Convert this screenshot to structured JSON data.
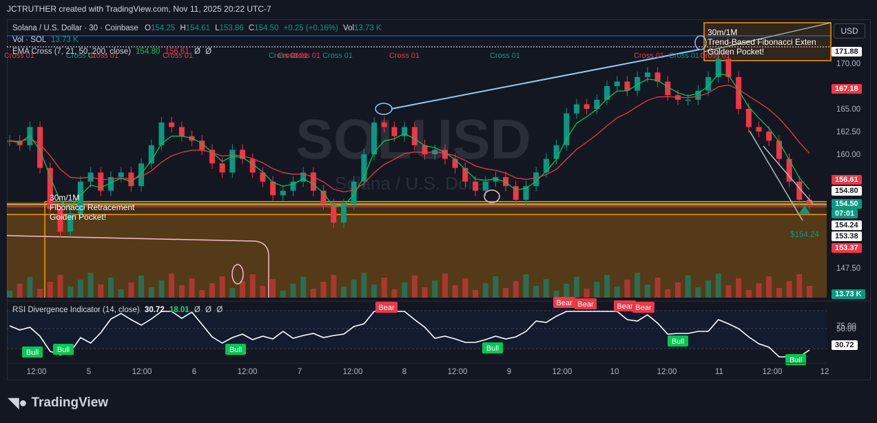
{
  "header": {
    "title": "JCTRUTHER created with TradingView.com, Nov 11, 2025 20:22 UTC-7"
  },
  "symbol": {
    "name": "Solana / U.S. Dollar · 30 · Coinbase",
    "o_label": "O",
    "o": "154.25",
    "h_label": "H",
    "h": "154.61",
    "l_label": "L",
    "l": "153.86",
    "c_label": "C",
    "c": "154.50",
    "change": "+0.25 (+0.16%)",
    "vol_label": "Vol",
    "vol": "13.73 K"
  },
  "vol_row": {
    "label": "Vol · SOL",
    "value": "13.73 K"
  },
  "ema_row": {
    "label": "EMA Cross (7, 21, 50, 200, close)",
    "v1": "154.80",
    "v2": "156.61",
    "v3": "Ø",
    "v4": "Ø"
  },
  "rsi_row": {
    "label": "RSI Divergence Indicator (14, close)",
    "v1": "30.72",
    "v2": "18.01",
    "v3": "Ø",
    "v4": "Ø",
    "v5": "Ø"
  },
  "currency_button": "USD",
  "watermark": {
    "ticker": "SOLUSD",
    "name": "Solana / U.S. Dollar"
  },
  "fib_left": {
    "line1": "30m/1M",
    "line2": "Fibonacci Retracement",
    "line3": "Golden Pocket!"
  },
  "fib_right": {
    "line1": "30m/1M",
    "line2": "Trend-Based Fibonacci Exten",
    "line3": "Golden Pocket!"
  },
  "cross_labels": [
    "Cross 01",
    "Cross 01",
    "Cross 01",
    "Cross 01",
    "Cross 01",
    "Cross 01",
    "Cross 01",
    "Cross 01",
    "Cross 01",
    "Cross 01",
    "Cross 01",
    "Cross 01",
    "Cross 01"
  ],
  "bull_label": "Bull",
  "bear_label": "Bear",
  "price_tags": [
    {
      "text": "171.88",
      "bg": "#ffffff",
      "fg": "#131722"
    },
    {
      "text": "167.18",
      "bg": "#f23645",
      "fg": "#ffffff"
    },
    {
      "text": "156.61",
      "bg": "#f23645",
      "fg": "#ffffff"
    },
    {
      "text": "154.80",
      "bg": "#ffffff",
      "fg": "#131722"
    },
    {
      "text": "154.50",
      "bg": "#089981",
      "fg": "#ffffff"
    },
    {
      "text": "07:01",
      "bg": "#089981",
      "fg": "#ffffff"
    },
    {
      "text": "154.24",
      "bg": "#ffffff",
      "fg": "#131722"
    },
    {
      "text": "153.38",
      "bg": "#ffffff",
      "fg": "#131722"
    },
    {
      "text": "153.37",
      "bg": "#f23645",
      "fg": "#ffffff"
    },
    {
      "text": "13.73 K",
      "bg": "#089981",
      "fg": "#ffffff"
    },
    {
      "text": "30.72",
      "bg": "#ffffff",
      "fg": "#131722"
    }
  ],
  "last_price_label": "$154.24",
  "logo": "TradingView",
  "colors": {
    "up": "#089981",
    "down": "#f23645",
    "ema_fast": "#00c853",
    "ema_slow": "#f23645",
    "fib_box": "#ff9800",
    "trendline": "#90caf9",
    "rsi": "#ffffff"
  },
  "chart_data": {
    "type": "candlestick",
    "symbol": "SOLUSD",
    "timeframe": "30",
    "y_axis_ticks": [
      145.0,
      147.5,
      150.0,
      152.5,
      155.0,
      157.5,
      160.0,
      162.5,
      165.0,
      167.5,
      170.0
    ],
    "y_axis_labels": [
      "147.50",
      "160.00",
      "162.50",
      "165.00",
      "170.00"
    ],
    "ylim": [
      145.0,
      172.5
    ],
    "x_axis_labels": [
      "12:00",
      "5",
      "12:00",
      "6",
      "12:00",
      "7",
      "12:00",
      "8",
      "12:00",
      "9",
      "12:00",
      "10",
      "12:00",
      "11",
      "12:00",
      "12"
    ],
    "key_levels": {
      "fib_upper": 154.8,
      "fib_lower": 153.38,
      "ema_fast": 154.8,
      "ema_slow": 156.61,
      "last": 154.5
    },
    "ohlc_last": {
      "open": 154.25,
      "high": 154.61,
      "low": 153.86,
      "close": 154.5
    },
    "close_path": [
      161.5,
      161.0,
      163.0,
      158.5,
      154.0,
      151.5,
      153.5,
      157.0,
      158.0,
      156.0,
      157.5,
      158.0,
      156.5,
      159.0,
      161.0,
      163.5,
      163.0,
      162.0,
      161.5,
      160.5,
      159.0,
      158.0,
      160.5,
      159.5,
      158.0,
      157.0,
      155.5,
      156.0,
      157.0,
      158.0,
      156.0,
      154.5,
      152.5,
      154.5,
      157.0,
      160.0,
      163.5,
      163.0,
      162.0,
      163.0,
      161.0,
      160.0,
      160.5,
      159.5,
      158.5,
      157.0,
      156.0,
      157.0,
      157.5,
      156.5,
      155.0,
      156.5,
      158.0,
      159.5,
      161.0,
      164.5,
      165.5,
      165.0,
      166.0,
      167.5,
      168.0,
      167.0,
      168.5,
      169.0,
      168.0,
      166.5,
      166.0,
      166.0,
      167.0,
      168.5,
      170.5,
      168.5,
      165.0,
      163.0,
      162.5,
      161.5,
      159.5,
      157.0,
      155.0,
      154.5
    ],
    "rsi": {
      "period": 14,
      "value": 30.72,
      "secondary": 18.01,
      "levels": [
        30,
        50,
        70
      ]
    }
  }
}
